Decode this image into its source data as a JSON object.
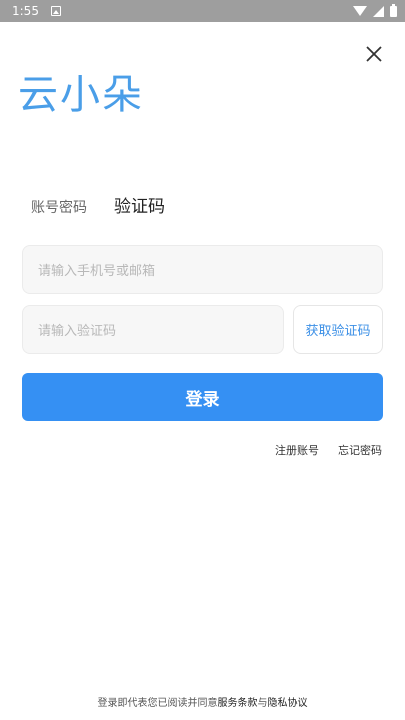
{
  "status_bar": {
    "time": "1:55"
  },
  "header": {
    "close_icon": "close-icon",
    "logo_text": "云小朵"
  },
  "tabs": {
    "password_label": "账号密码",
    "code_label": "验证码"
  },
  "form": {
    "phone_placeholder": "请输入手机号或邮箱",
    "code_placeholder": "请输入验证码",
    "get_code_label": "获取验证码",
    "login_label": "登录"
  },
  "links": {
    "register": "注册账号",
    "forgot": "忘记密码"
  },
  "agreement": {
    "prefix": "登录即代表您已阅读并同意",
    "terms": "服务条款",
    "and": "与",
    "privacy": "隐私协议"
  },
  "colors": {
    "status_bar_bg": "#9e9e9e",
    "logo": "#4a9ee8",
    "primary": "#3590f3",
    "link_blue": "#3b8fe6"
  }
}
